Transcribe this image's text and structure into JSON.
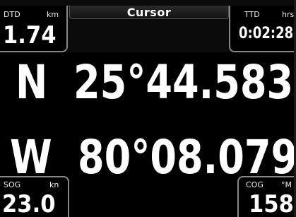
{
  "title": "Cursor",
  "dtd": {
    "label": "DTD",
    "unit": "km",
    "value": "1.74"
  },
  "ttd": {
    "label": "TTD",
    "unit": "hrs",
    "value": "0:02:28"
  },
  "latitude": {
    "hemisphere": "N",
    "value": "25°44.583'"
  },
  "longitude": {
    "hemisphere": "W",
    "value": "80°08.079'"
  },
  "sog": {
    "label": "SOG",
    "unit": "kn",
    "value": "23.0"
  },
  "cog": {
    "label": "COG",
    "unit": "°M",
    "value": "158"
  }
}
